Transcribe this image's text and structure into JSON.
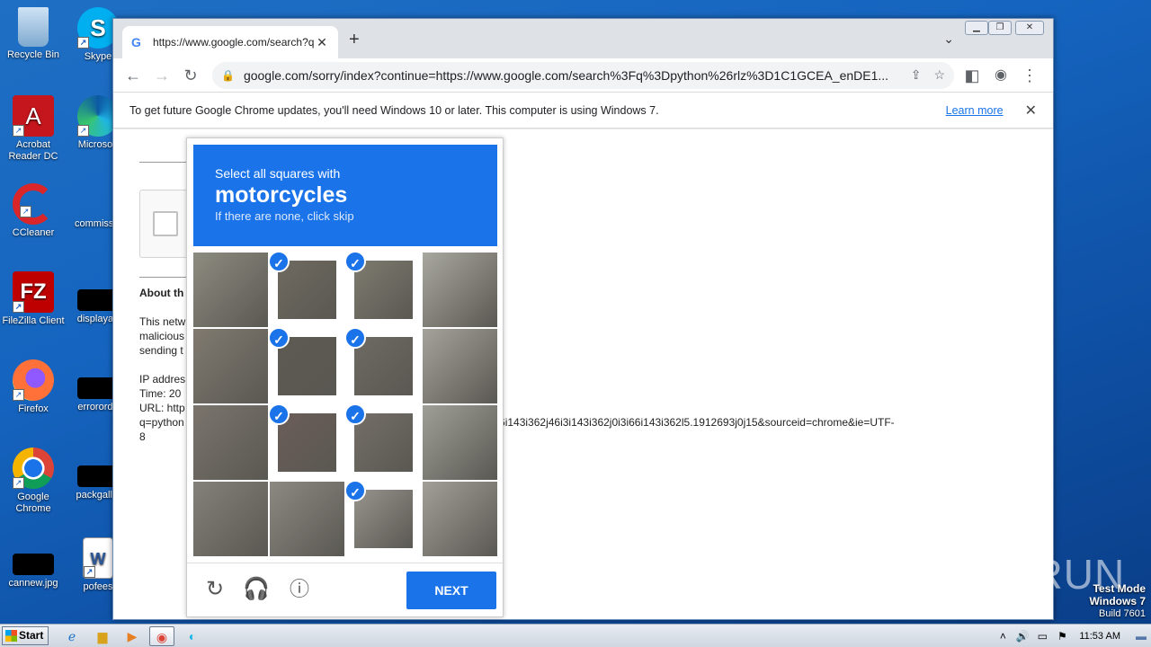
{
  "desktop": {
    "icons_col1": [
      {
        "label": "Recycle Bin",
        "icon": "recycle-bin-icon"
      },
      {
        "label": "Acrobat Reader DC",
        "icon": "acrobat-icon"
      },
      {
        "label": "CCleaner",
        "icon": "ccleaner-icon"
      },
      {
        "label": "FileZilla Client",
        "icon": "filezilla-icon"
      },
      {
        "label": "Firefox",
        "icon": "firefox-icon"
      },
      {
        "label": "Google Chrome",
        "icon": "chrome-icon"
      },
      {
        "label": "cannew.jpg",
        "icon": "image-file-icon"
      }
    ],
    "icons_col2": [
      {
        "label": "Skype",
        "icon": "skype-icon"
      },
      {
        "label": "Microsoft",
        "icon": "edge-icon"
      },
      {
        "label": "commissio",
        "icon": "file-icon"
      },
      {
        "label": "displayau",
        "icon": "file-icon"
      },
      {
        "label": "errororde",
        "icon": "file-icon"
      },
      {
        "label": "packgallei",
        "icon": "file-icon"
      },
      {
        "label": "pofees",
        "icon": "word-icon"
      }
    ]
  },
  "browser": {
    "tab_title": "https://www.google.com/search?q=",
    "address": "google.com/sorry/index?continue=https://www.google.com/search%3Fq%3Dpython%26rlz%3D1C1GCEA_enDE1...",
    "infobar": {
      "message": "To get future Google Chrome updates, you'll need Windows 10 or later. This computer is using Windows 7.",
      "link": "Learn more"
    }
  },
  "page": {
    "about_heading": "About th",
    "para_lines": [
      "This netw",
      "malicious",
      "sending t"
    ],
    "ip_lines": [
      "IP addres",
      "Time: 20",
      "URL: http"
    ],
    "url_tail_left": "q=python",
    "url_tail_right": "3i66i143i362j46i3i143i362j0i3i66i143i362l5.1912693j0j15&sourceid=chrome&ie=UTF-",
    "url_end": "8"
  },
  "captcha": {
    "line1": "Select all squares with",
    "target": "motorcycles",
    "hint": "If there are none, click skip",
    "next_label": "NEXT",
    "tiles_selected": [
      false,
      true,
      true,
      false,
      false,
      true,
      true,
      false,
      false,
      true,
      true,
      false,
      false,
      false,
      true,
      false
    ]
  },
  "watermark": {
    "text": "ANY RUN"
  },
  "test_mode": {
    "line1": "Test Mode",
    "line2": "Windows 7",
    "line3": "Build 7601"
  },
  "taskbar": {
    "start_label": "Start",
    "clock": "11:53 AM"
  }
}
